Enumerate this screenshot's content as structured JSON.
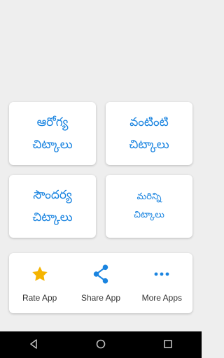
{
  "cards": [
    {
      "line1": "ఆరోగ్య",
      "line2": "చిట్కాలు"
    },
    {
      "line1": "వంటింటి",
      "line2": "చిట్కాలు"
    },
    {
      "line1": "సౌందర్య",
      "line2": "చిట్కాలు"
    },
    {
      "line1": "మరిన్ని",
      "line2": "చిట్కాలు"
    }
  ],
  "actions": {
    "rate": {
      "label": "Rate App",
      "icon": "star-icon"
    },
    "share": {
      "label": "Share App",
      "icon": "share-icon"
    },
    "more": {
      "label": "More Apps",
      "icon": "more-horizontal-icon"
    }
  },
  "colors": {
    "accent": "#1a84e0",
    "star": "#f5b400",
    "background": "#eeeeee"
  },
  "navbar": {
    "back": "back-icon",
    "home": "home-icon",
    "recents": "recents-icon"
  }
}
